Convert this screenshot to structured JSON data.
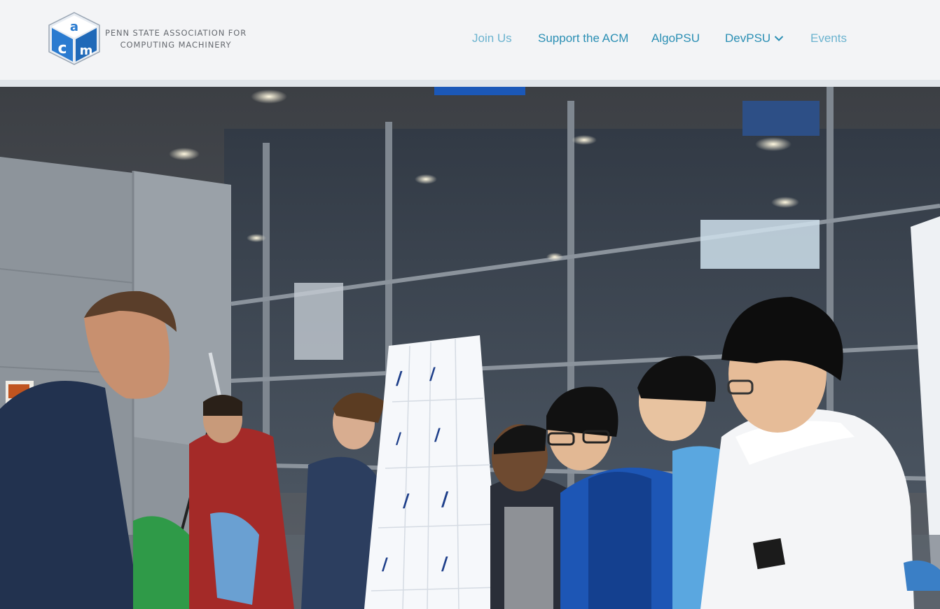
{
  "logo": {
    "line1": "PENN STATE ASSOCIATION FOR",
    "line2": "COMPUTING MACHINERY",
    "icon": "acm-cube-logo"
  },
  "nav": {
    "join_us": "Join Us",
    "support": "Support the ACM",
    "algopsu": "AlgoPSU",
    "devpsu": "DevPSU",
    "events": "Events"
  },
  "hero": {
    "image": "students-at-acm-table-with-cup-tower"
  },
  "colors": {
    "nav_link": "#2b8fb4",
    "nav_link_muted": "#6bb3cf",
    "header_bg": "#f3f4f6",
    "logo_blue": "#2a7bd0"
  }
}
